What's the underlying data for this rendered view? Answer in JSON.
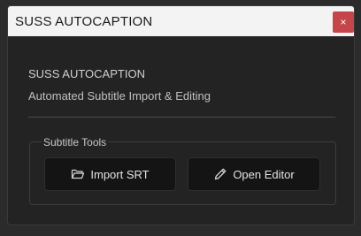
{
  "window": {
    "title": "SUSS AUTOCAPTION",
    "close_glyph": "×"
  },
  "header": {
    "app_name": "SUSS AUTOCAPTION",
    "description": "Automated Subtitle Import & Editing"
  },
  "tools": {
    "group_label": "Subtitle Tools",
    "import_label": "Import SRT",
    "import_icon": "folder-open-icon",
    "editor_label": "Open Editor",
    "editor_icon": "pencil-icon"
  },
  "colors": {
    "close_button": "#c4464b",
    "background": "#232323",
    "button_bg": "#141414"
  }
}
